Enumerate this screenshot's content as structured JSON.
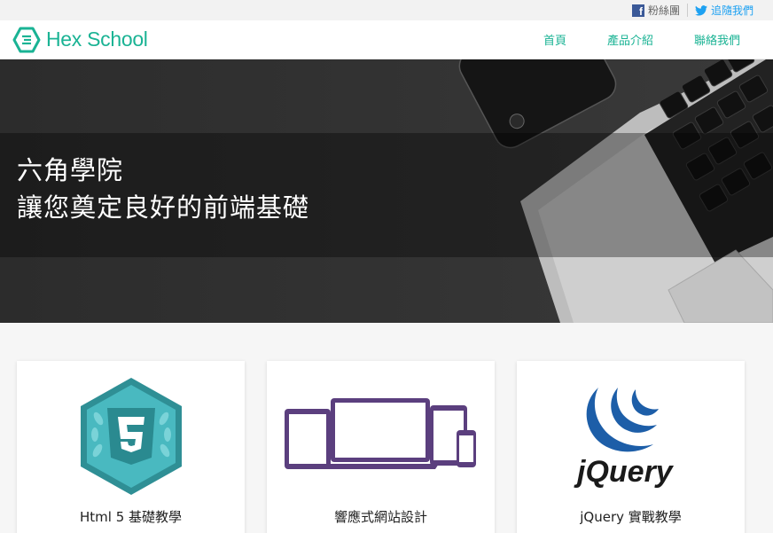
{
  "topbar": {
    "facebook_label": "粉絲團",
    "twitter_label": "追隨我們"
  },
  "header": {
    "logo_text": "Hex School",
    "nav": [
      {
        "label": "首頁"
      },
      {
        "label": "產品介紹"
      },
      {
        "label": "聯絡我們"
      }
    ]
  },
  "hero": {
    "line1": "六角學院",
    "line2": "讓您奠定良好的前端基礎"
  },
  "cards": [
    {
      "title": "Html 5 基礎教學",
      "icon": "html5-icon"
    },
    {
      "title": "響應式網站設計",
      "icon": "responsive-devices-icon"
    },
    {
      "title": "jQuery 實戰教學",
      "icon": "jquery-logo",
      "logo_text": "jQuery"
    }
  ],
  "colors": {
    "brand": "#1ab394",
    "facebook": "#3b5998",
    "twitter": "#1da1f2",
    "html5_badge": "#3fb0b7",
    "responsive": "#5b3f7e",
    "jquery_blue": "#1d5ea8"
  }
}
